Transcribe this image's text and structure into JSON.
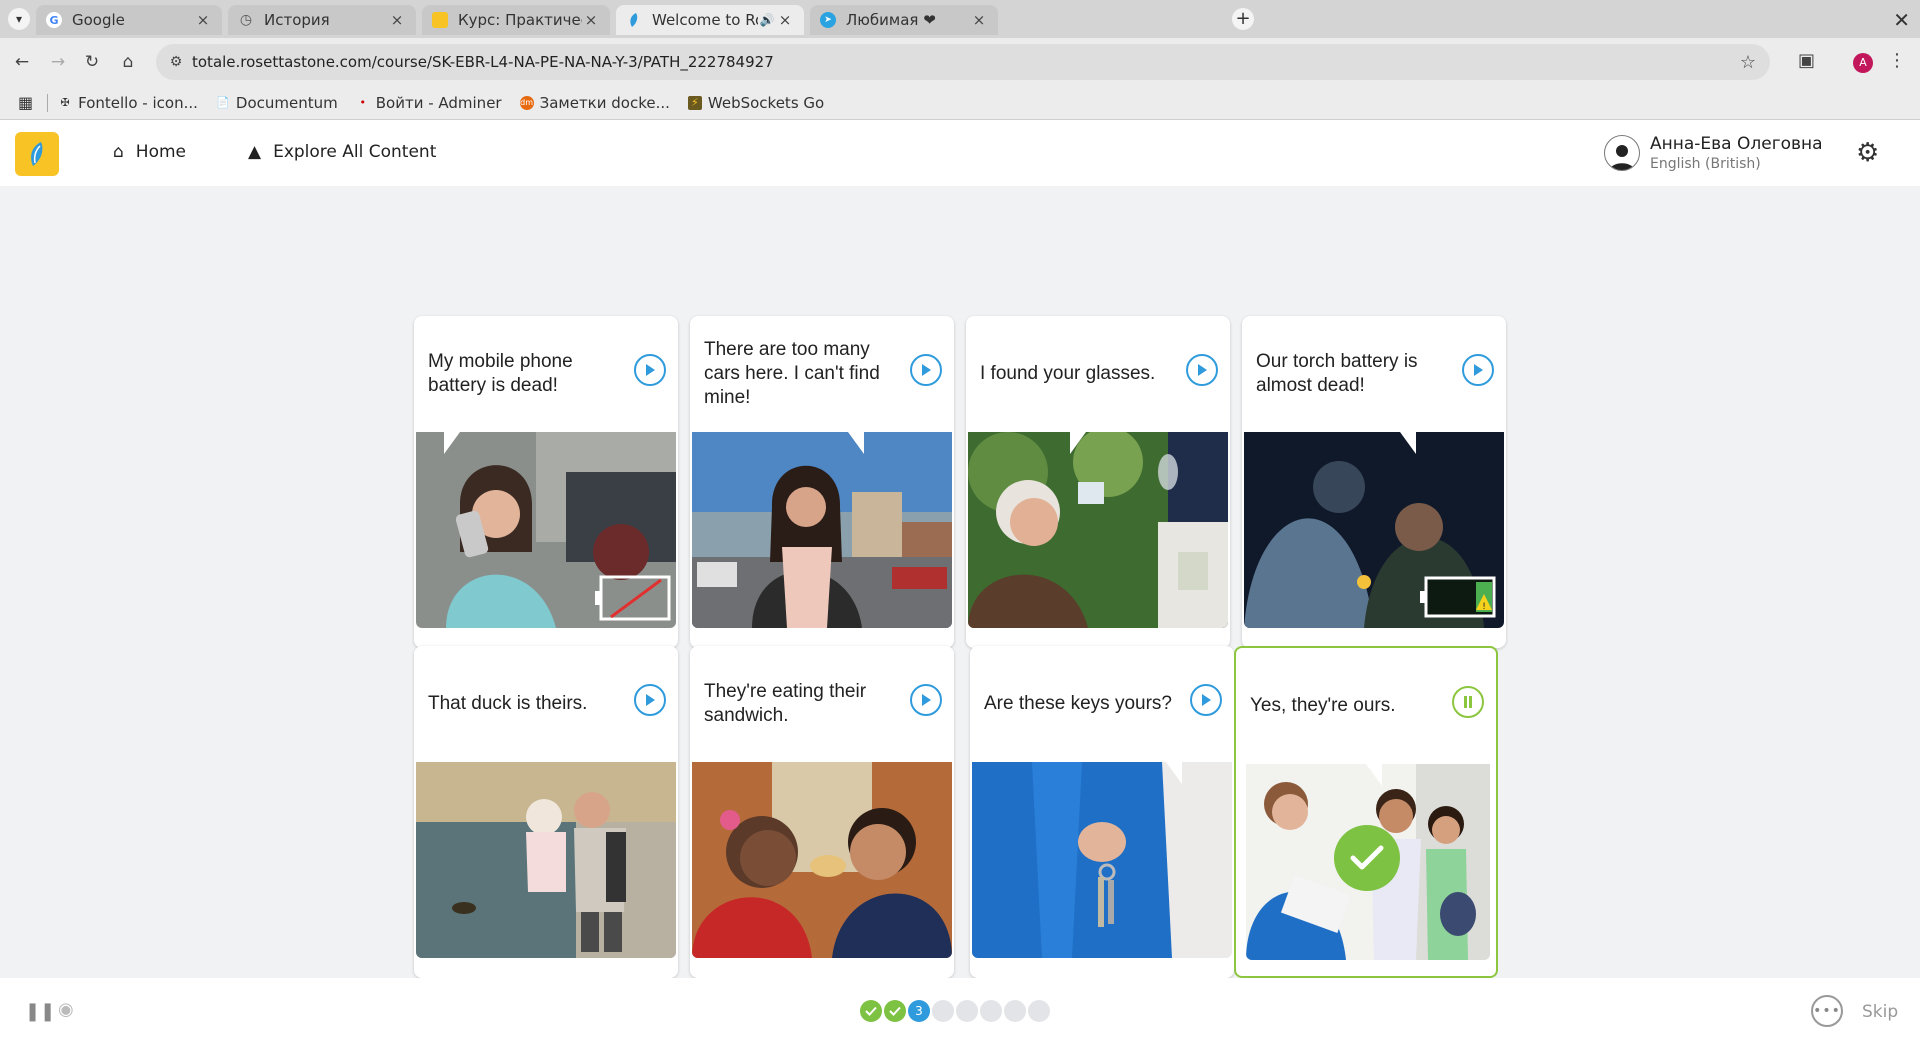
{
  "browser": {
    "tabs": [
      {
        "title": "Google",
        "icon": "google-icon",
        "active": false
      },
      {
        "title": "История",
        "icon": "history-icon",
        "active": false
      },
      {
        "title": "Курс: Практический кур",
        "icon": "course-icon",
        "active": false
      },
      {
        "title": "Welcome to Rosetta S",
        "icon": "rosetta-icon",
        "active": true
      },
      {
        "title": "Любимая ❤",
        "icon": "telegram-icon",
        "active": false
      }
    ],
    "tab_close_glyph": "×",
    "new_tab_glyph": "+",
    "url": "totale.rosettastone.com/course/SK-EBR-L4-NA-PE-NA-NA-Y-3/PATH_222784927",
    "profile_initial": "A",
    "bookmarks": [
      {
        "label": "Fontello - icon...",
        "icon": "fontello-icon"
      },
      {
        "label": "Documentum",
        "icon": "document-icon"
      },
      {
        "label": "Войти - Adminer",
        "icon": "adminer-icon"
      },
      {
        "label": "Заметки docke...",
        "icon": "notes-icon"
      },
      {
        "label": "WebSockets Go",
        "icon": "websockets-icon"
      }
    ]
  },
  "app": {
    "nav": {
      "home_label": "Home",
      "explore_label": "Explore All Content"
    },
    "user": {
      "name": "Анна-Ева Олеговна",
      "language": "English (British)"
    }
  },
  "lesson": {
    "cards": [
      {
        "caption": "My mobile phone battery is dead!",
        "state": "play"
      },
      {
        "caption": "There are too many cars here. I can't find mine!",
        "state": "play"
      },
      {
        "caption": "I found your glasses.",
        "state": "play"
      },
      {
        "caption": "Our torch battery is almost dead!",
        "state": "play"
      },
      {
        "caption": "That duck is theirs.",
        "state": "play"
      },
      {
        "caption": "They're eating their sandwich.",
        "state": "play"
      },
      {
        "caption": "Are these keys yours?",
        "state": "play"
      },
      {
        "caption": "Yes, they're ours.",
        "state": "playing",
        "selected": true,
        "correct": true
      }
    ]
  },
  "footer": {
    "progress": {
      "total": 8,
      "completed": 2,
      "current_number": "3"
    },
    "skip_label": "Skip"
  },
  "colors": {
    "accent_blue": "#2f9bdc",
    "correct_green": "#7dc242",
    "brand_yellow": "#f7c325"
  }
}
